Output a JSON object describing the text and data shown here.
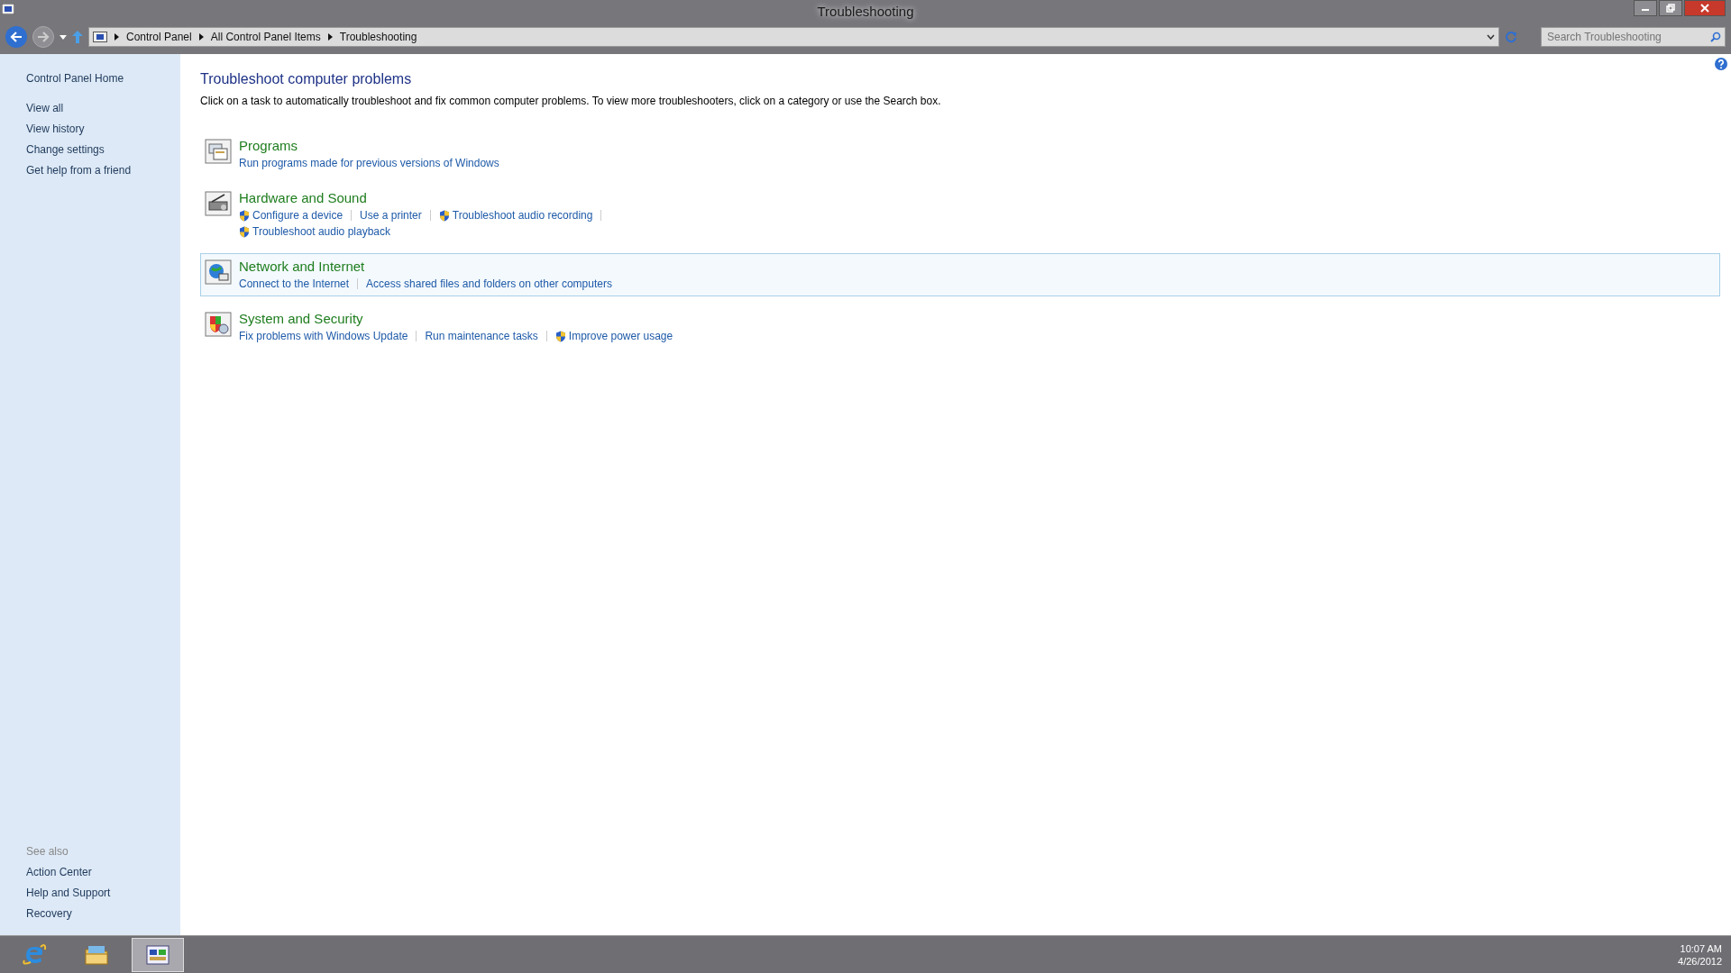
{
  "window": {
    "title": "Troubleshooting"
  },
  "address_bar": {
    "breadcrumbs": [
      "Control Panel",
      "All Control Panel Items",
      "Troubleshooting"
    ]
  },
  "search": {
    "placeholder": "Search Troubleshooting"
  },
  "sidebar": {
    "home": "Control Panel Home",
    "items": [
      "View all",
      "View history",
      "Change settings",
      "Get help from a friend"
    ],
    "see_also_label": "See also",
    "see_also": [
      "Action Center",
      "Help and Support",
      "Recovery"
    ]
  },
  "main": {
    "title": "Troubleshoot computer problems",
    "description": "Click on a task to automatically troubleshoot and fix common computer problems. To view more troubleshooters, click on a category or use the Search box.",
    "categories": [
      {
        "title": "Programs",
        "kind": "programs",
        "highlighted": false,
        "links": [
          [
            {
              "text": "Run programs made for previous versions of Windows",
              "shield": false
            }
          ]
        ]
      },
      {
        "title": "Hardware and Sound",
        "kind": "hardware",
        "highlighted": false,
        "links": [
          [
            {
              "text": "Configure a device",
              "shield": true
            },
            {
              "text": "Use a printer",
              "shield": false
            },
            {
              "text": "Troubleshoot audio recording",
              "shield": true
            }
          ],
          [
            {
              "text": "Troubleshoot audio playback",
              "shield": true
            }
          ]
        ]
      },
      {
        "title": "Network and Internet",
        "kind": "network",
        "highlighted": true,
        "links": [
          [
            {
              "text": "Connect to the Internet",
              "shield": false
            },
            {
              "text": "Access shared files and folders on other computers",
              "shield": false
            }
          ]
        ]
      },
      {
        "title": "System and Security",
        "kind": "security",
        "highlighted": false,
        "links": [
          [
            {
              "text": "Fix problems with Windows Update",
              "shield": false
            },
            {
              "text": "Run maintenance tasks",
              "shield": false
            },
            {
              "text": "Improve power usage",
              "shield": true
            }
          ]
        ]
      }
    ]
  },
  "taskbar": {
    "apps": [
      {
        "kind": "ie",
        "selected": false
      },
      {
        "kind": "explorer",
        "selected": false
      },
      {
        "kind": "control",
        "selected": true
      }
    ],
    "time": "10:07 AM",
    "date": "4/26/2012"
  }
}
